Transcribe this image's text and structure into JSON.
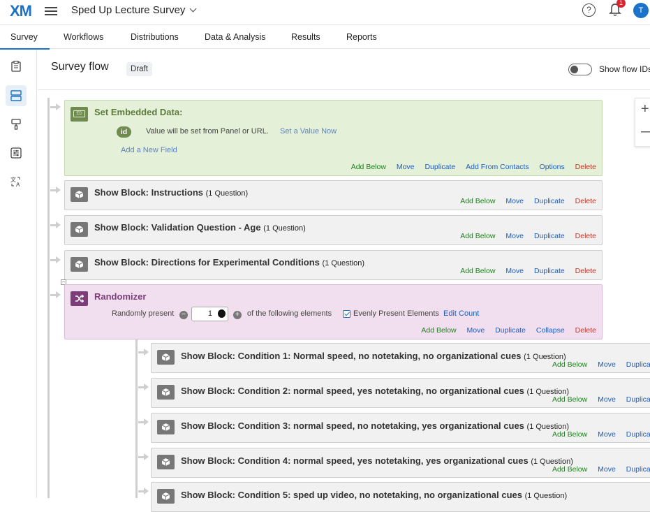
{
  "header": {
    "logo": "XM",
    "survey_title": "Sped Up Lecture Survey",
    "help_glyph": "?",
    "notification_count": "1",
    "avatar_initial": "T"
  },
  "tabs": [
    {
      "label": "Survey",
      "active": true
    },
    {
      "label": "Workflows"
    },
    {
      "label": "Distributions"
    },
    {
      "label": "Data & Analysis"
    },
    {
      "label": "Results"
    },
    {
      "label": "Reports"
    }
  ],
  "rail": [
    "survey-icon",
    "survey-flow-icon",
    "look-and-feel-icon",
    "survey-options-icon",
    "translate-icon"
  ],
  "page": {
    "title": "Survey flow",
    "status": "Draft",
    "toggle_label": "Show flow IDs"
  },
  "zoom": {
    "in": "+",
    "out": "—"
  },
  "embedded": {
    "title": "Set Embedded Data:",
    "field": "id",
    "value_text": "Value will be set from Panel or URL.",
    "set_value": "Set a Value Now",
    "add_field": "Add a New Field",
    "actions": [
      "Add Below",
      "Move",
      "Duplicate",
      "Add From Contacts",
      "Options",
      "Delete"
    ]
  },
  "blocks": [
    {
      "name": "Show Block: Instructions",
      "count": "(1 Question)"
    },
    {
      "name": "Show Block: Validation Question - Age",
      "count": "(1 Question)"
    },
    {
      "name": "Show Block: Directions for Experimental Conditions",
      "count": "(1 Question)"
    }
  ],
  "block_actions": [
    "Add Below",
    "Move",
    "Duplicate",
    "Delete"
  ],
  "randomizer": {
    "title": "Randomizer",
    "present_label": "Randomly present",
    "value": "1",
    "following": "of the following elements",
    "evenly": "Evenly Present Elements",
    "edit_count": "Edit Count",
    "actions": [
      "Add Below",
      "Move",
      "Duplicate",
      "Collapse",
      "Delete"
    ]
  },
  "conditions": [
    {
      "name": "Show Block: Condition 1:  Normal speed, no notetaking, no organizational cues",
      "count": "(1 Question)"
    },
    {
      "name": "Show Block: Condition 2: normal speed, yes notetaking, no organizational cues",
      "count": "(1 Question)"
    },
    {
      "name": "Show Block: Condition 3:  normal speed, no notetaking, yes organizational cues",
      "count": "(1 Question)"
    },
    {
      "name": "Show Block: Condition 4: normal speed, yes notetaking, yes organizational cues",
      "count": "(1 Question)"
    },
    {
      "name": "Show Block: Condition 5: sped up video, no notetaking, no organizational cues",
      "count": "(1 Question)"
    }
  ],
  "condition_actions": [
    "Add Below",
    "Move",
    "Duplicate"
  ],
  "colors": {
    "accent": "#1a73c8",
    "embedded_bg": "#e4f0d8",
    "randomizer_bg": "#f1dff0",
    "block_bg": "#f1f1f1",
    "delete": "#c0392b",
    "add": "#217d21"
  }
}
